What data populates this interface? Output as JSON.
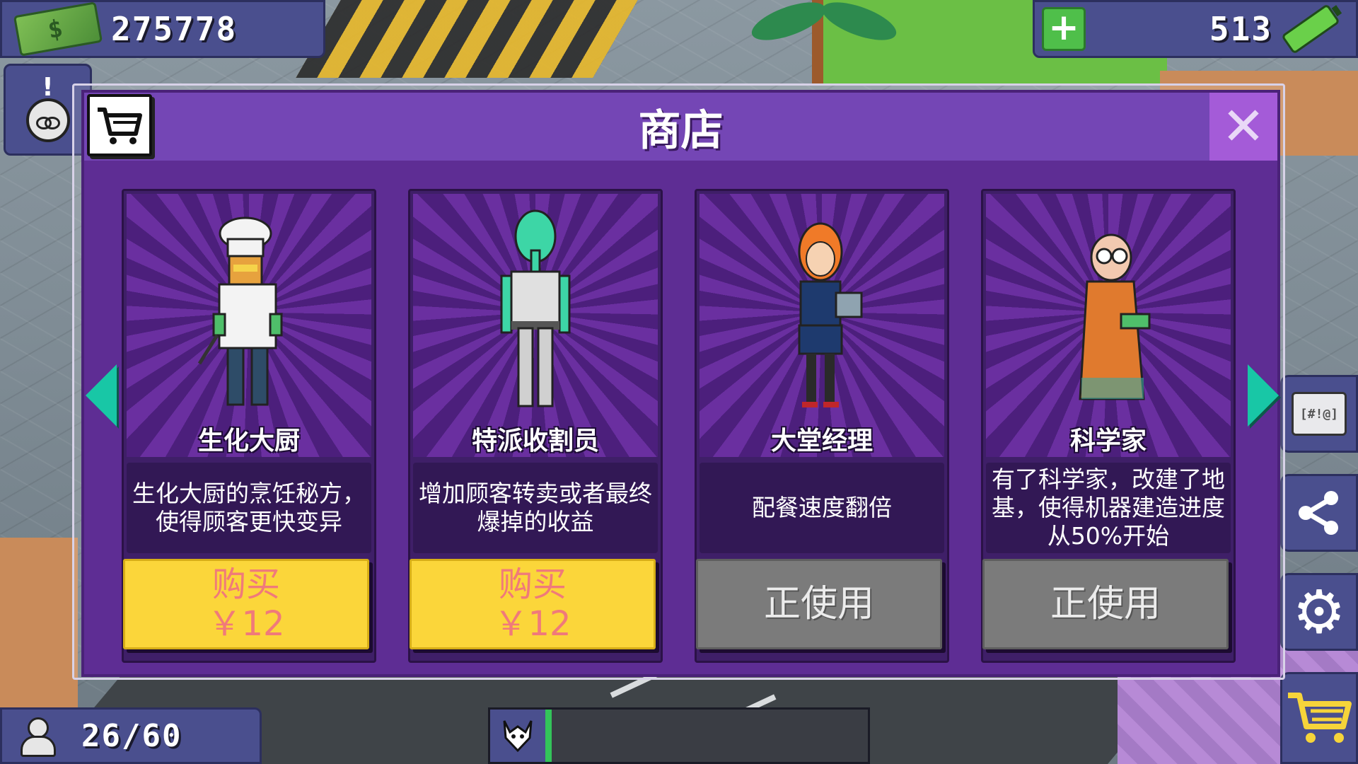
{
  "hud": {
    "money": "275778",
    "energy": "513",
    "add_energy_label": "+",
    "alert_mark": "!",
    "population": "26/60",
    "progress_fraction": 0.02
  },
  "shop": {
    "title": "商店",
    "close_label": "✕",
    "cards": [
      {
        "name": "生化大厨",
        "description": "生化大厨的烹饪秘方，使得顾客更快变异",
        "button_line1": "购买",
        "button_line2": "￥12",
        "state": "buy"
      },
      {
        "name": "特派收割员",
        "description": "增加顾客转卖或者最终爆掉的收益",
        "button_line1": "购买",
        "button_line2": "￥12",
        "state": "buy"
      },
      {
        "name": "大堂经理",
        "description": "配餐速度翻倍",
        "button_line1": "正使用",
        "button_line2": "",
        "state": "inuse"
      },
      {
        "name": "科学家",
        "description": "有了科学家，改建了地基，使得机器建造进度从50%开始",
        "button_line1": "正使用",
        "button_line2": "",
        "state": "inuse"
      }
    ]
  },
  "side": {
    "gift_label": "[#!@]",
    "share_glyph": "⋖",
    "settings_glyph": "⚙"
  },
  "colors": {
    "panel": "#5e2d94",
    "header": "#7446b5",
    "buy_button": "#fbd63a",
    "inuse_button": "#7b7b7b",
    "arrow": "#18c7a6"
  },
  "icons": [
    "money-icon",
    "add-icon",
    "battery-icon",
    "alert-icon",
    "cart-icon",
    "close-icon",
    "arrow-left-icon",
    "arrow-right-icon",
    "person-icon",
    "mutant-icon",
    "gift-icon",
    "share-icon",
    "gear-icon"
  ]
}
